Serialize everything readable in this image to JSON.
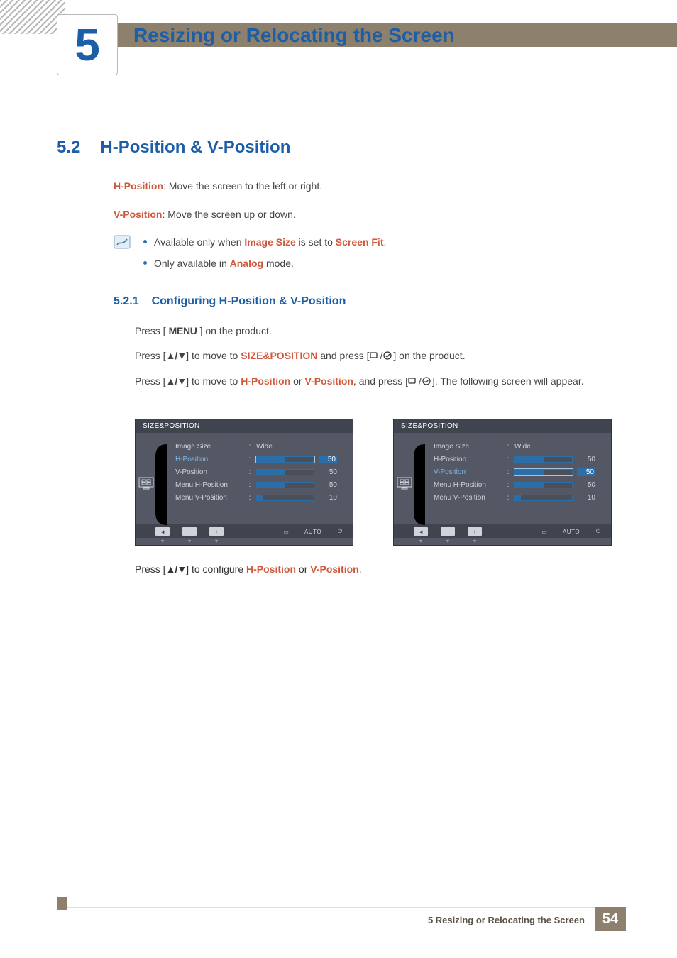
{
  "header": {
    "chapter_number": "5",
    "chapter_title": "Resizing or Relocating the Screen"
  },
  "section": {
    "number": "5.2",
    "title": "H-Position & V-Position"
  },
  "hpos_desc": {
    "term": "H-Position",
    "text": ": Move the screen to the left or right."
  },
  "vpos_desc": {
    "term": "V-Position",
    "text": ": Move the screen up or down."
  },
  "notes": {
    "n1": {
      "pre": "Available only when ",
      "k1": "Image Size",
      "mid": " is set to ",
      "k2": "Screen Fit",
      "post": "."
    },
    "n2": {
      "pre": "Only available in ",
      "k1": "Analog",
      "post": " mode."
    }
  },
  "subsection": {
    "number": "5.2.1",
    "title": "Configuring H-Position & V-Position"
  },
  "steps": {
    "s1": {
      "pref": "Press [",
      "menu": "MENU",
      "suf": "] on the product."
    },
    "s2": {
      "pref": "Press [",
      "ud": "▲/▼",
      "mid": "] to move to ",
      "k1": "SIZE&POSITION",
      "mid2": " and press [",
      "suf": "] on the product."
    },
    "s3": {
      "pref": "Press [",
      "ud": "▲/▼",
      "mid": "] to move to ",
      "k1": "H-Position",
      "or": " or ",
      "k2": "V-Position",
      "mid2": ", and press [",
      "suf": "]. The following screen will appear."
    },
    "s4": {
      "pref": "Press [",
      "ud": "▲/▼",
      "mid": "] to configure ",
      "k1": "H-Position",
      "or": " or ",
      "k2": "V-Position",
      "post": "."
    }
  },
  "osd": {
    "title": "SIZE&POSITION",
    "wide": "Wide",
    "rows": {
      "r1": "Image Size",
      "r2": "H-Position",
      "r3": "V-Position",
      "r4": "Menu H-Position",
      "r5": "Menu V-Position"
    },
    "vals": {
      "v2": "50",
      "v3": "50",
      "v4": "50",
      "v5": "10"
    },
    "auto": "AUTO"
  },
  "footer": {
    "label": "5 Resizing or Relocating the Screen",
    "page": "54"
  }
}
